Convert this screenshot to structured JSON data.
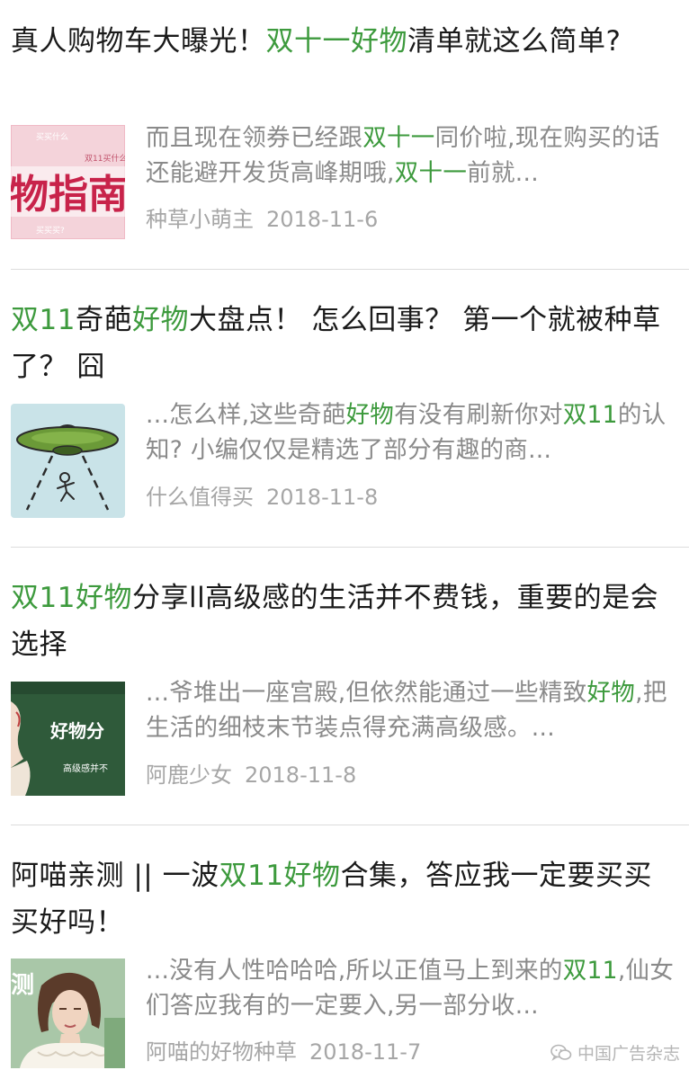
{
  "colors": {
    "highlight": "#3d9a3d",
    "title_text": "#1a1a1a",
    "snippet_text": "#8a8a8a",
    "meta_text": "#a6a6a6"
  },
  "results": [
    {
      "title": {
        "p1": "真人购物车大曝光！",
        "hl1": "双十一好物",
        "p2": "清单就这么简单?"
      },
      "thumb_icon": "shopping-guide-thumbnail",
      "thumb_text": {
        "big": "物指南",
        "small_top": "买买什么",
        "small_right": "双11买什么",
        "small_bottom": "买买买?"
      },
      "snippet": {
        "p1": "而且现在领券已经跟",
        "hl1": "双十一",
        "p2": "同价啦,现在购买的话还能避开发货高峰期哦,",
        "hl2": "双十一",
        "p3": "前就..."
      },
      "source": "种草小萌主",
      "date": "2018-11-6"
    },
    {
      "title": {
        "hl1": "双11",
        "p1": "奇葩",
        "hl2": "好物",
        "p2": "大盘点！ 怎么回事？ 第一个就被种草了？ 囧"
      },
      "thumb_icon": "ufo-illustration-thumbnail",
      "snippet": {
        "p1": "...怎么样,这些奇葩",
        "hl1": "好物",
        "p2": "有没有刷新你对",
        "hl2": "双11",
        "p3": "的认知? 小编仅仅是精选了部分有趣的商..."
      },
      "source": "什么值得买",
      "date": "2018-11-8"
    },
    {
      "title": {
        "hl1": "双11好物",
        "p1": "分享ll高级感的生活并不费钱，重要的是会选择"
      },
      "thumb_icon": "green-chalkboard-thumbnail",
      "thumb_text": {
        "big": "好物分",
        "small": "高级感并不"
      },
      "snippet": {
        "p1": "...爷堆出一座宫殿,但依然能通过一些精致",
        "hl1": "好物",
        "p2": ",把生活的细枝末节装点得充满高级感。..."
      },
      "source": "阿鹿少女",
      "date": "2018-11-8"
    },
    {
      "title": {
        "p1": "阿喵亲测 || 一波",
        "hl1": "双11好物",
        "p2": "合集，答应我一定要买买买好吗！"
      },
      "thumb_icon": "woman-portrait-thumbnail",
      "thumb_text": {
        "big": "测"
      },
      "snippet": {
        "p1": "...没有人性哈哈哈,所以正值马上到来的",
        "hl1": "双11",
        "p2": ",仙女们答应我有的一定要入,另一部分收..."
      },
      "source": "阿喵的好物种草",
      "date": "2018-11-7"
    }
  ],
  "watermark": {
    "text": "中国广告杂志",
    "icon": "wechat-icon"
  }
}
